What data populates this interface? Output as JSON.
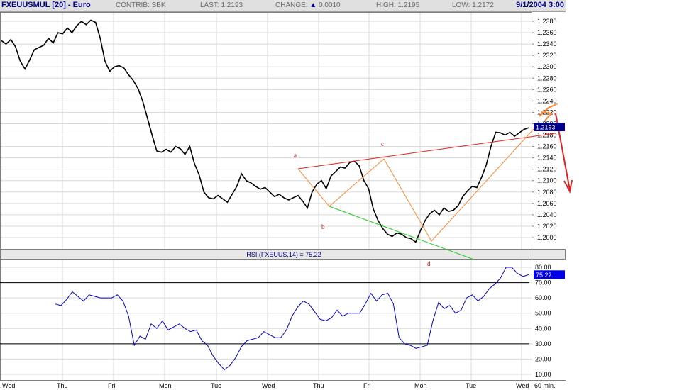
{
  "header": {
    "symbol": "FXEUUSMUL [20] - Euro",
    "contrib_label": "CONTRIB:",
    "contrib_value": "SBK",
    "last_label": "LAST:",
    "last_value": "1.2193",
    "change_label": "CHANGE:",
    "change_arrow": "▲",
    "change_value": "0.0010",
    "high_label": "HIGH:",
    "high_value": "1.2195",
    "low_label": "LOW:",
    "low_value": "1.2172",
    "datetime": "9/1/2004 3:00"
  },
  "colors": {
    "price": "#000000",
    "rsi": "#0000cc",
    "trend_red": "#dd2222",
    "trend_green": "#22cc22",
    "wave_orange": "#ff8833",
    "badge": "#000088",
    "rsi_badge": "#0000ee"
  },
  "chart_data": [
    {
      "type": "line",
      "panel": "price",
      "ylim": [
        1.19,
        1.24
      ],
      "y_ticks": [
        "1.2380",
        "1.2360",
        "1.2340",
        "1.2320",
        "1.2300",
        "1.2280",
        "1.2260",
        "1.2240",
        "1.2220",
        "1.2200",
        "1.2180",
        "1.2160",
        "1.2140",
        "1.2120",
        "1.2100",
        "1.2080",
        "1.2060",
        "1.2040",
        "1.2020",
        "1.2000"
      ],
      "x_labels": [
        "Wed",
        "Thu",
        "Fri",
        "Mon",
        "Tue",
        "Wed",
        "Thu",
        "Fri",
        "Mon",
        "Tue",
        "Wed",
        "60 min."
      ],
      "last_price_badge": "1.2193",
      "close": [
        1.2346,
        1.234,
        1.2348,
        1.2335,
        1.231,
        1.2296,
        1.2312,
        1.233,
        1.2334,
        1.2338,
        1.235,
        1.2342,
        1.236,
        1.2358,
        1.2368,
        1.236,
        1.2372,
        1.238,
        1.2374,
        1.2382,
        1.2378,
        1.235,
        1.231,
        1.2292,
        1.23,
        1.2302,
        1.2298,
        1.2286,
        1.2276,
        1.2262,
        1.224,
        1.221,
        1.218,
        1.2152,
        1.215,
        1.2155,
        1.215,
        1.216,
        1.2156,
        1.2146,
        1.216,
        1.213,
        1.211,
        1.208,
        1.207,
        1.2068,
        1.2074,
        1.2068,
        1.2062,
        1.2076,
        1.209,
        1.2112,
        1.21,
        1.2096,
        1.209,
        1.2085,
        1.2088,
        1.208,
        1.2072,
        1.2076,
        1.207,
        1.2066,
        1.207,
        1.2074,
        1.2064,
        1.2052,
        1.208,
        1.2094,
        1.21,
        1.2086,
        1.2108,
        1.2116,
        1.2124,
        1.2122,
        1.2132,
        1.2134,
        1.2126,
        1.21,
        1.2086,
        1.205,
        1.203,
        1.2016,
        1.2006,
        1.2002,
        1.2008,
        1.2006,
        1.2,
        1.1998,
        1.1992,
        1.2012,
        1.203,
        1.2042,
        1.2048,
        1.204,
        1.2052,
        1.2046,
        1.2048,
        1.2056,
        1.2072,
        1.2082,
        1.209,
        1.2088,
        1.2106,
        1.2128,
        1.216,
        1.2185,
        1.2184,
        1.218,
        1.2185,
        1.2178,
        1.2184,
        1.219,
        1.2193
      ]
    },
    {
      "type": "line",
      "panel": "rsi",
      "title": "RSI (FXEUUS,14) = 75.22",
      "ylim": [
        5,
        85
      ],
      "y_ticks": [
        "80.00",
        "70.00",
        "60.00",
        "50.00",
        "40.00",
        "30.00",
        "20.00",
        "10.00"
      ],
      "reference_lines": [
        70,
        30
      ],
      "last_value_badge": "75.22",
      "values": [
        56,
        55,
        59,
        64,
        61,
        58,
        62,
        61,
        60,
        60,
        60,
        62,
        58,
        48,
        29,
        35,
        33,
        43,
        40,
        45,
        39,
        41,
        43,
        40,
        38,
        39,
        32,
        29,
        22,
        17,
        13,
        16,
        21,
        28,
        32,
        33,
        34,
        38,
        36,
        34,
        34,
        39,
        48,
        54,
        58,
        56,
        51,
        46,
        45,
        47,
        52,
        48,
        50,
        50,
        50,
        56,
        63,
        58,
        62,
        63,
        56,
        34,
        30,
        29,
        27,
        28,
        29,
        45,
        57,
        53,
        55,
        50,
        52,
        60,
        62,
        58,
        61,
        66,
        69,
        73,
        80,
        80,
        76,
        74,
        75.22
      ]
    }
  ],
  "annotations": {
    "a": "a",
    "b": "b",
    "c": "c",
    "d": "d"
  }
}
